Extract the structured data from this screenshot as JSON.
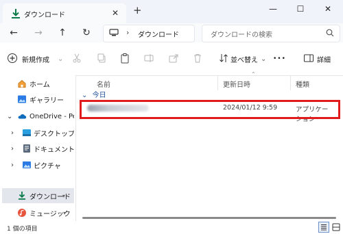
{
  "window": {
    "tab_title": "ダウンロード",
    "tab_close": "✕",
    "new_tab": "+",
    "minimize": "—",
    "maximize": "☐",
    "close": "✕"
  },
  "nav": {
    "back": "←",
    "forward": "→",
    "up": "↑",
    "refresh": "↻",
    "breadcrumb_sep": "›",
    "address": "ダウンロード",
    "search_placeholder": "ダウンロードの検索"
  },
  "toolbar": {
    "new_label": "新規作成",
    "new_chevron": "⌄",
    "sort_label": "並べ替え",
    "sort_chevron": "⌄",
    "more": "•••",
    "details_label": "詳細"
  },
  "sidebar": {
    "items": [
      {
        "label": "ホーム",
        "icon": "home-icon"
      },
      {
        "label": "ギャラリー",
        "icon": "gallery-icon"
      },
      {
        "label": "OneDrive - Pers",
        "icon": "onedrive-icon",
        "arrow": "⌄"
      },
      {
        "label": "デスクトップ",
        "icon": "desktop-folder-icon",
        "arrow": "›"
      },
      {
        "label": "ドキュメント",
        "icon": "documents-folder-icon",
        "arrow": "›"
      },
      {
        "label": "ピクチャ",
        "icon": "pictures-folder-icon",
        "arrow": "›"
      },
      {
        "label": "ダウンロード",
        "icon": "download-icon",
        "pin": "📌"
      },
      {
        "label": "ミュージック",
        "icon": "music-icon",
        "pin": "📌"
      }
    ]
  },
  "columns": {
    "name": "名前",
    "modified": "更新日時",
    "type": "種類",
    "sort_caret": "⌃"
  },
  "group": {
    "label": "今日",
    "chevron": "⌄"
  },
  "file": {
    "modified": "2024/01/12 9:59",
    "type": "アプリケーション"
  },
  "status": {
    "count_text": "1 個の項目"
  },
  "colors": {
    "accent": "#0a7a4b",
    "highlight": "#e11b1b",
    "folder": "#f5c542"
  }
}
